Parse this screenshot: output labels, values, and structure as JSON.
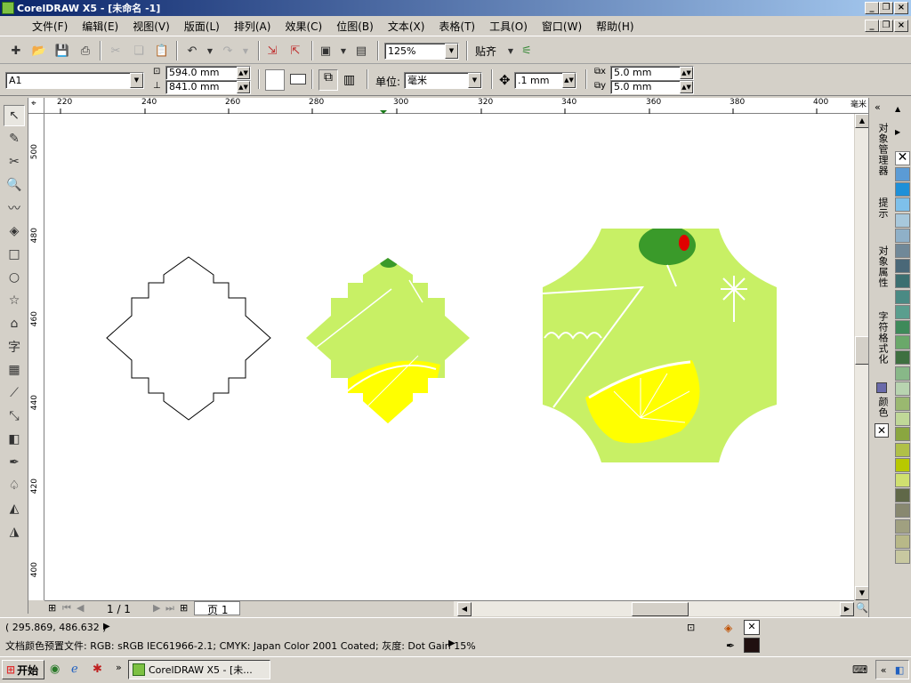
{
  "window": {
    "title": "CorelDRAW X5 - [未命名 -1]"
  },
  "menu": [
    "文件(F)",
    "编辑(E)",
    "视图(V)",
    "版面(L)",
    "排列(A)",
    "效果(C)",
    "位图(B)",
    "文本(X)",
    "表格(T)",
    "工具(O)",
    "窗口(W)",
    "帮助(H)"
  ],
  "toolbar": {
    "zoom": "125%",
    "snap_label": "贴齐"
  },
  "propbar": {
    "page_preset": "A1",
    "width": "594.0 mm",
    "height": "841.0 mm",
    "unit_label": "单位:",
    "unit": "毫米",
    "nudge": ".1 mm",
    "dup_x": "5.0 mm",
    "dup_y": "5.0 mm"
  },
  "ruler_h": [
    "220",
    "240",
    "260",
    "280",
    "300",
    "320",
    "340",
    "360",
    "380",
    "400"
  ],
  "ruler_h_unit": "毫米",
  "ruler_v": [
    "500",
    "480",
    "460",
    "440",
    "420",
    "400"
  ],
  "pagebar": {
    "page_count": "1 / 1",
    "page_tab": "页 1"
  },
  "dockers": [
    "对象管理器",
    "提示",
    "对象属性",
    "字符格式化",
    "颜色"
  ],
  "status": {
    "coords": "( 295.869, 486.632 )",
    "profile": "文档颜色预置文件: RGB: sRGB IEC61966-2.1; CMYK: Japan Color 2001 Coated; 灰度: Dot Gain 15%"
  },
  "taskbar": {
    "start": "开始",
    "task": "CorelDRAW X5 - [未..."
  },
  "palette_colors": [
    "#ffffff",
    "#5b9bd5",
    "#1e90d8",
    "#7ec0ea",
    "#a8c8dc",
    "#8fb0c8",
    "#708898",
    "#4a6878",
    "#3b6f70",
    "#4a8a84",
    "#5a9e8e",
    "#3e8a5a",
    "#6aa86a",
    "#3e7040",
    "#88b888",
    "#b8d4b0",
    "#9ab870",
    "#c0d898",
    "#8aa640",
    "#b0c048",
    "#b8c800",
    "#d0e070",
    "#606848",
    "#888870",
    "#a0a080",
    "#b8b888",
    "#c8c8a0"
  ]
}
